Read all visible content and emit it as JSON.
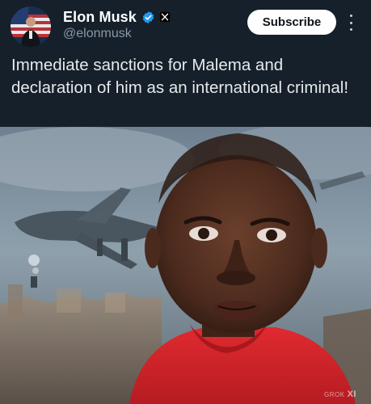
{
  "post": {
    "author": {
      "display_name": "Elon Musk",
      "handle": "@elonmusk",
      "verified": true,
      "affiliation_badge": "x-logo-icon"
    },
    "subscribe_label": "Subscribe",
    "text": "Immediate sanctions for Malema and declaration of him as an international criminal!",
    "media": {
      "watermark_text": "GROK",
      "watermark_mark": "XI"
    }
  },
  "icons": {
    "verified": "verified-check-icon",
    "affiliation": "x-logo-icon",
    "more": "more-vertical-icon"
  },
  "colors": {
    "background": "#15202b",
    "verified_blue": "#1d9bf0",
    "handle_gray": "#8b98a5",
    "button_bg": "#ffffff",
    "shirt_red": "#d8262e"
  }
}
